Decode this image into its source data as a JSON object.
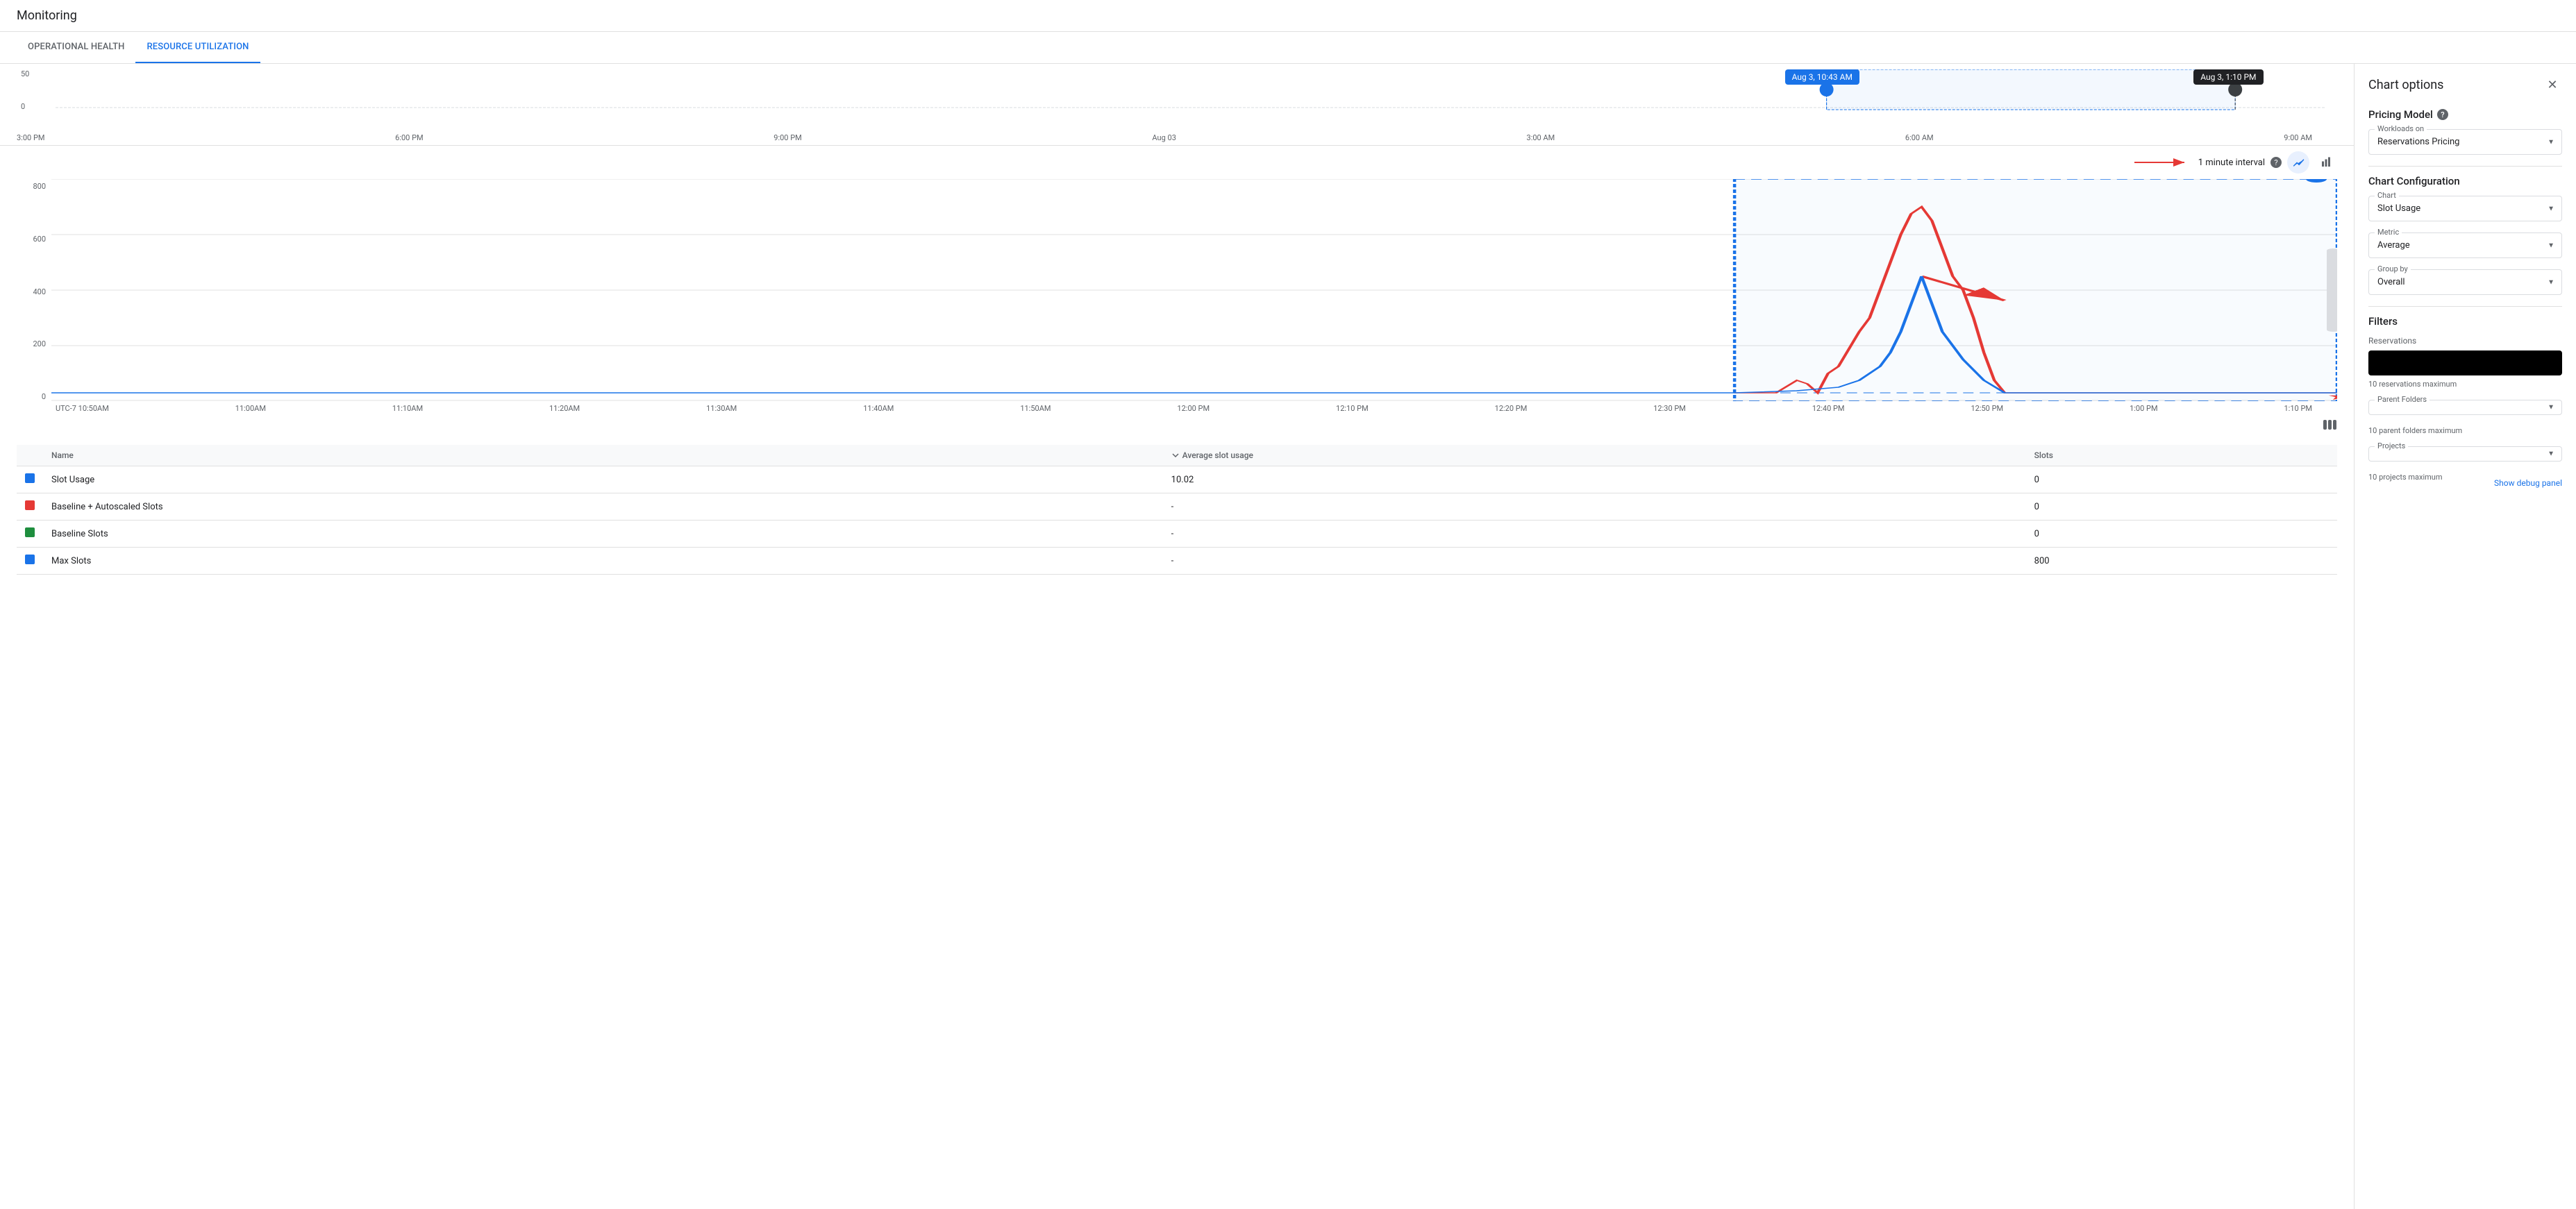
{
  "app": {
    "title": "Monitoring"
  },
  "tabs": [
    {
      "id": "operational-health",
      "label": "OPERATIONAL HEALTH",
      "active": false
    },
    {
      "id": "resource-utilization",
      "label": "RESOURCE UTILIZATION",
      "active": true
    }
  ],
  "sidebar": {
    "title": "Chart options",
    "pricing_model": {
      "label": "Pricing Model",
      "workloads_label": "Workloads on",
      "workloads_value": "Reservations Pricing"
    },
    "chart_config": {
      "title": "Chart Configuration",
      "chart_label": "Chart",
      "chart_value": "Slot Usage",
      "metric_label": "Metric",
      "metric_value": "Average",
      "group_by_label": "Group by",
      "group_by_value": "Overall"
    },
    "filters": {
      "title": "Filters",
      "reservations_label": "Reservations",
      "reservations_hint": "10 reservations maximum",
      "parent_folders_label": "Parent Folders",
      "parent_folders_hint": "10 parent folders maximum",
      "projects_label": "Projects",
      "projects_hint": "10 projects maximum",
      "debug_label": "Show debug panel"
    }
  },
  "interval": {
    "label": "1 minute interval"
  },
  "overview_chart": {
    "y_labels": [
      "50",
      "0"
    ],
    "time_labels": [
      "3:00 PM",
      "6:00 PM",
      "9:00 PM",
      "Aug 03",
      "3:00 AM",
      "6:00 AM",
      "9:00 AM"
    ]
  },
  "main_chart": {
    "y_labels": [
      "800",
      "600",
      "400",
      "200",
      "0"
    ],
    "time_labels": [
      "UTC-7  10:50AM",
      "11:00AM",
      "11:10AM",
      "11:20AM",
      "11:30AM",
      "11:40AM",
      "11:50AM",
      "12:00 PM",
      "12:10 PM",
      "12:20 PM",
      "12:30 PM",
      "12:40 PM",
      "12:50 PM",
      "1:00 PM",
      "1:10 PM"
    ],
    "tooltip1": "Aug 3, 10:43 AM",
    "tooltip2": "Aug 3, 1:10 PM"
  },
  "table": {
    "columns": [
      "",
      "Name",
      "Average slot usage",
      "Slots"
    ],
    "rows": [
      {
        "color": "#1a73e8",
        "name": "Slot Usage",
        "avg": "10.02",
        "slots": "0"
      },
      {
        "color": "#e53935",
        "name": "Baseline + Autoscaled Slots",
        "avg": "-",
        "slots": "0"
      },
      {
        "color": "#1e8e3e",
        "name": "Baseline Slots",
        "avg": "-",
        "slots": "0"
      },
      {
        "color": "#1a73e8",
        "name": "Max Slots",
        "avg": "-",
        "slots": "800"
      }
    ]
  }
}
